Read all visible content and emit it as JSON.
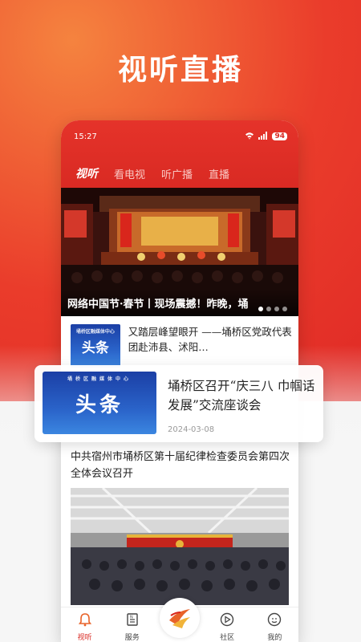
{
  "hero": {
    "title": "视听直播"
  },
  "status_bar": {
    "time": "15:27",
    "battery": "94"
  },
  "tabs": [
    {
      "label": "视听",
      "active": true
    },
    {
      "label": "看电视",
      "active": false
    },
    {
      "label": "听广播",
      "active": false
    },
    {
      "label": "直播",
      "active": false
    }
  ],
  "banner": {
    "caption": "网络中国节·春节丨现场震撼！昨晚，埇"
  },
  "news": [
    {
      "thumb_text": "头条",
      "thumb_brand": "埇桥区融媒体中心",
      "title": "又踏层峰望眼开 ——埇桥区党政代表团赴沛县、沭阳…"
    },
    {
      "thumb_text": "头条",
      "thumb_brand": "埇桥区融媒体中心",
      "title": "埇桥区召开“庆三八 巾帼话发展”交流座谈会",
      "date": "2024-03-08"
    },
    {
      "title": "中共宿州市埇桥区第十届纪律检查委员会第四次全体会议召开"
    }
  ],
  "bottom_nav": [
    {
      "label": "视听",
      "icon": "bell-icon",
      "active": true
    },
    {
      "label": "服务",
      "icon": "document-icon",
      "active": false
    },
    {
      "label": "",
      "icon": "app-logo-icon",
      "active": false
    },
    {
      "label": "社区",
      "icon": "play-icon",
      "active": false
    },
    {
      "label": "我的",
      "icon": "user-icon",
      "active": false
    }
  ],
  "colors": {
    "brand_red": "#d92a23",
    "accent_orange": "#f06a3a"
  }
}
